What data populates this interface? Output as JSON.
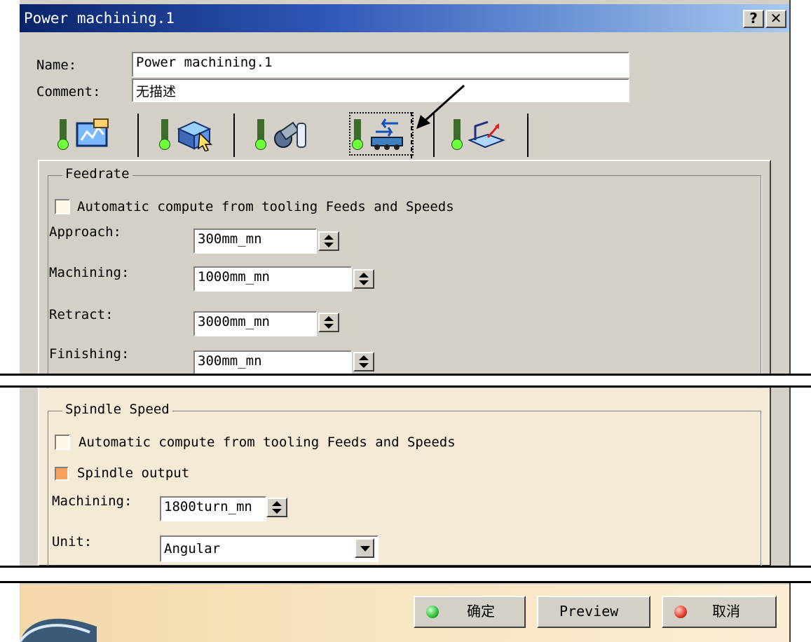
{
  "window": {
    "title": "Power machining.1",
    "help_label": "?",
    "close_label": "✕"
  },
  "form": {
    "name_label": "Name:",
    "name_value": "Power machining.1",
    "comment_label": "Comment:",
    "comment_value": "无描述"
  },
  "tabs": [
    {
      "icon": "strategy-icon"
    },
    {
      "icon": "geometry-icon"
    },
    {
      "icon": "tool-icon"
    },
    {
      "icon": "feeds-speeds-icon",
      "selected": true
    },
    {
      "icon": "macro-icon"
    }
  ],
  "feedrate": {
    "title": "Feedrate",
    "auto_label": "Automatic compute from tooling Feeds and Speeds",
    "auto_checked": false,
    "rows": [
      {
        "label": "Approach:",
        "value": "300mm_mn"
      },
      {
        "label": "Machining:",
        "value": "1000mm_mn"
      },
      {
        "label": "Retract:",
        "value": "3000mm_mn"
      },
      {
        "label": "Finishing:",
        "value": "300mm_mn"
      }
    ]
  },
  "spindle": {
    "title": "Spindle Speed",
    "auto_label": "Automatic compute from tooling Feeds and Speeds",
    "auto_checked": false,
    "output_label": "Spindle output",
    "output_checked": true,
    "machining_label": "Machining:",
    "machining_value": "1800turn_mn",
    "unit_label": "Unit:",
    "unit_value": "Angular"
  },
  "buttons": {
    "ok": "确定",
    "preview": "Preview",
    "cancel": "取消"
  },
  "colors": {
    "title_start": "#0a246a",
    "title_end": "#a6caf0",
    "footer": "#f7e3bd",
    "ok_ball": "#2fbf3a",
    "cancel_ball": "#e03a2a"
  }
}
